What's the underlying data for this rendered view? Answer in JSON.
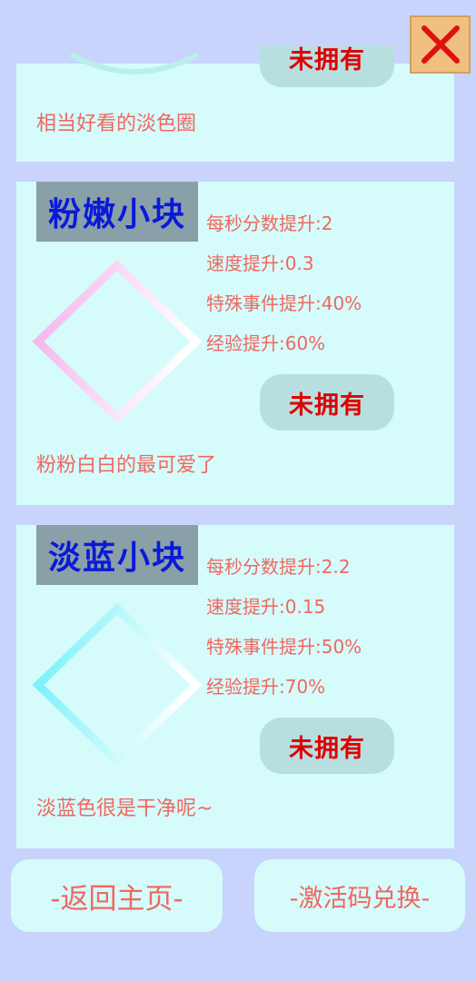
{
  "top_item": {
    "status_label": "未拥有",
    "description": "相当好看的淡色圈"
  },
  "items": [
    {
      "name": "粉嫩小块",
      "stats": [
        "每秒分数提升:2",
        "速度提升:0.3",
        "特殊事件提升:40%",
        "经验提升:60%"
      ],
      "status_label": "未拥有",
      "description": "粉粉白白的最可爱了",
      "colors": {
        "gradient_start": "#f4b2ec",
        "gradient_end": "#ffffff"
      }
    },
    {
      "name": "淡蓝小块",
      "stats": [
        "每秒分数提升:2.2",
        "速度提升:0.15",
        "特殊事件提升:50%",
        "经验提升:70%"
      ],
      "status_label": "未拥有",
      "description": "淡蓝色很是干净呢~",
      "colors": {
        "gradient_start": "#6ff0f8",
        "gradient_end": "#ffffff"
      }
    }
  ],
  "buttons": {
    "home": "-返回主页-",
    "redeem": "-激活码兑换-"
  },
  "colors": {
    "background": "#c8d4fc",
    "card": "#d6fbfb",
    "accent_text": "#ef6860",
    "title_text": "#0a1ad8",
    "status_text": "#e00000",
    "close_button": "#f0c080"
  },
  "icons": {
    "close": "close-x-icon"
  }
}
